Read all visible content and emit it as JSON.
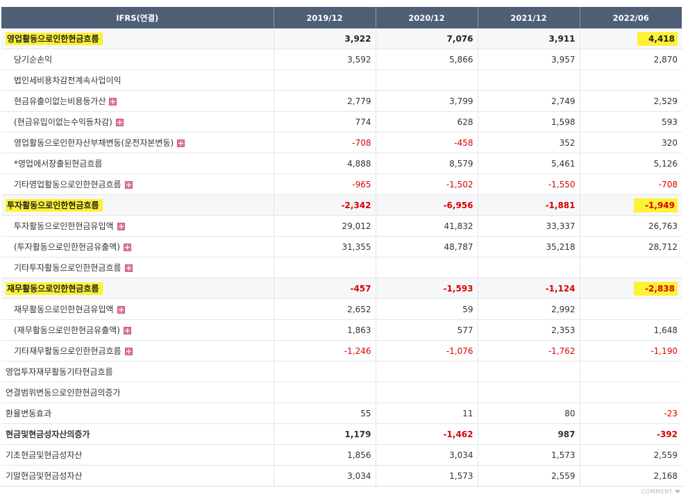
{
  "header": {
    "label_col": "IFRS(연결)",
    "periods": [
      "2019/12",
      "2020/12",
      "2021/12",
      "2022/06"
    ]
  },
  "rows": [
    {
      "label": "영업활동으로인한현금흐름",
      "main": true,
      "values": [
        "3,922",
        "7,076",
        "3,911",
        "4,418"
      ]
    },
    {
      "label": "당기순손익",
      "values": [
        "3,592",
        "5,866",
        "3,957",
        "2,870"
      ]
    },
    {
      "label": "법인세비용차감전계속사업이익",
      "values": [
        "",
        "",
        "",
        ""
      ]
    },
    {
      "label": "현금유출이없는비용등가산",
      "expand": true,
      "values": [
        "2,779",
        "3,799",
        "2,749",
        "2,529"
      ]
    },
    {
      "label": "(현금유입이없는수익등차감)",
      "expand": true,
      "values": [
        "774",
        "628",
        "1,598",
        "593"
      ]
    },
    {
      "label": "영업활동으로인한자산부채변동(운전자본변동)",
      "expand": true,
      "values": [
        "-708",
        "-458",
        "352",
        "320"
      ]
    },
    {
      "label": "*영업에서창출된현금흐름",
      "values": [
        "4,888",
        "8,579",
        "5,461",
        "5,126"
      ]
    },
    {
      "label": "기타영업활동으로인한현금흐름",
      "expand": true,
      "values": [
        "-965",
        "-1,502",
        "-1,550",
        "-708"
      ]
    },
    {
      "label": "투자활동으로인한현금흐름",
      "main": true,
      "values": [
        "-2,342",
        "-6,956",
        "-1,881",
        "-1,949"
      ]
    },
    {
      "label": "투자활동으로인한현금유입액",
      "expand": true,
      "values": [
        "29,012",
        "41,832",
        "33,337",
        "26,763"
      ]
    },
    {
      "label": "(투자활동으로인한현금유출액)",
      "expand": true,
      "values": [
        "31,355",
        "48,787",
        "35,218",
        "28,712"
      ]
    },
    {
      "label": "기타투자활동으로인한현금흐름",
      "expand": true,
      "values": [
        "",
        "",
        "",
        ""
      ]
    },
    {
      "label": "재무활동으로인한현금흐름",
      "main": true,
      "values": [
        "-457",
        "-1,593",
        "-1,124",
        "-2,838"
      ]
    },
    {
      "label": "재무활동으로인한현금유입액",
      "expand": true,
      "values": [
        "2,652",
        "59",
        "2,992",
        ""
      ]
    },
    {
      "label": "(재무활동으로인한현금유출액)",
      "expand": true,
      "values": [
        "1,863",
        "577",
        "2,353",
        "1,648"
      ]
    },
    {
      "label": "기타재무활동으로인한현금흐름",
      "expand": true,
      "values": [
        "-1,246",
        "-1,076",
        "-1,762",
        "-1,190"
      ]
    },
    {
      "label": "영업투자재무활동기타현금흐름",
      "top": true,
      "values": [
        "",
        "",
        "",
        ""
      ]
    },
    {
      "label": "연결범위변동으로인한현금의증가",
      "top": true,
      "values": [
        "",
        "",
        "",
        ""
      ]
    },
    {
      "label": "환율변동효과",
      "top": true,
      "values": [
        "55",
        "11",
        "80",
        "-23"
      ]
    },
    {
      "label": "현금및현금성자산의증가",
      "top": true,
      "bold": true,
      "values": [
        "1,179",
        "-1,462",
        "987",
        "-392"
      ]
    },
    {
      "label": "기초현금및현금성자산",
      "top": true,
      "values": [
        "1,856",
        "3,034",
        "1,573",
        "2,559"
      ]
    },
    {
      "label": "기말현금및현금성자산",
      "top": true,
      "values": [
        "3,034",
        "1,573",
        "2,559",
        "2,168"
      ]
    }
  ],
  "footer": {
    "comment_label": "COMMENT"
  },
  "colors": {
    "header_bg": "#4e5f76",
    "negative": "#d90000",
    "highlight": "#fdf233"
  }
}
